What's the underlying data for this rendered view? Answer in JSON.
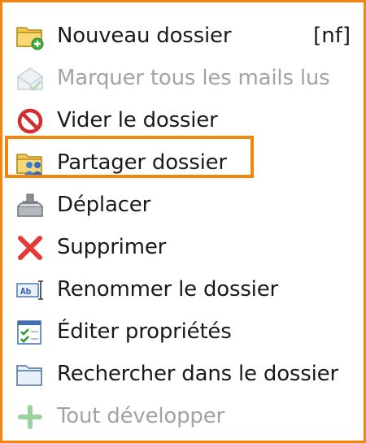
{
  "menu": {
    "accent_color": "#f5860d",
    "items": [
      {
        "label": "Nouveau dossier",
        "shortcut": "[nf]",
        "icon": "new-folder-icon",
        "enabled": true
      },
      {
        "label": "Marquer tous les mails lus",
        "icon": "mark-read-envelope-icon",
        "enabled": false
      },
      {
        "label": "Vider le dossier",
        "icon": "no-entry-icon",
        "enabled": true
      },
      {
        "label": "Partager dossier",
        "icon": "shared-folder-icon",
        "enabled": true,
        "highlighted": true
      },
      {
        "label": "Déplacer",
        "icon": "move-tray-icon",
        "enabled": true
      },
      {
        "label": "Supprimer",
        "icon": "red-x-icon",
        "enabled": true
      },
      {
        "label": "Renommer le dossier",
        "icon": "rename-field-icon",
        "enabled": true
      },
      {
        "label": "Éditer propriétés",
        "icon": "properties-checklist-icon",
        "enabled": true
      },
      {
        "label": "Rechercher dans le dossier",
        "icon": "folder-outline-icon",
        "enabled": true
      },
      {
        "label": "Tout développer",
        "icon": "plus-icon",
        "enabled": false
      }
    ]
  }
}
